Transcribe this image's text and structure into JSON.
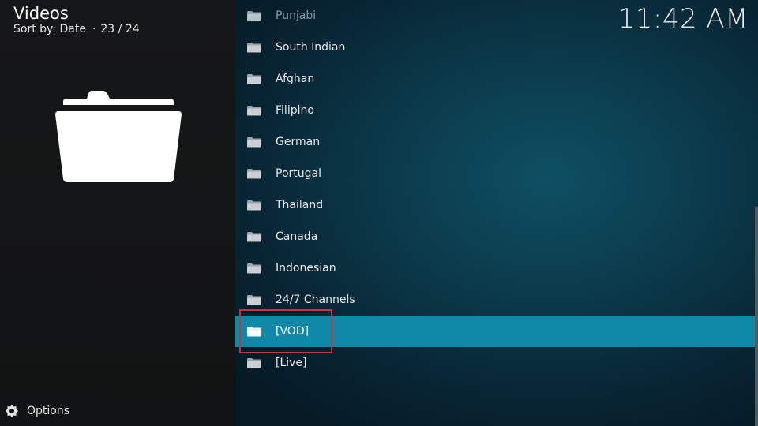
{
  "header": {
    "title": "Videos",
    "sort_label": "Sort by: Date",
    "position": "23 / 24"
  },
  "clock": "11:42 AM",
  "footer": {
    "options_label": "Options"
  },
  "list": {
    "items": [
      {
        "label": "Punjabi",
        "state": "faded"
      },
      {
        "label": "South Indian",
        "state": "normal"
      },
      {
        "label": "Afghan",
        "state": "normal"
      },
      {
        "label": "Filipino",
        "state": "normal"
      },
      {
        "label": "German",
        "state": "normal"
      },
      {
        "label": "Portugal",
        "state": "normal"
      },
      {
        "label": "Thailand",
        "state": "normal"
      },
      {
        "label": "Canada",
        "state": "normal"
      },
      {
        "label": "Indonesian",
        "state": "normal"
      },
      {
        "label": "24/7 Channels",
        "state": "normal"
      },
      {
        "label": "[VOD]",
        "state": "selected"
      },
      {
        "label": "[Live]",
        "state": "normal"
      }
    ]
  },
  "icons": {
    "folder": "folder-icon",
    "options": "gear-options-icon"
  },
  "colors": {
    "selected_row": "#1089a8",
    "highlight_box": "#c0353f",
    "left_panel": "#141516"
  }
}
